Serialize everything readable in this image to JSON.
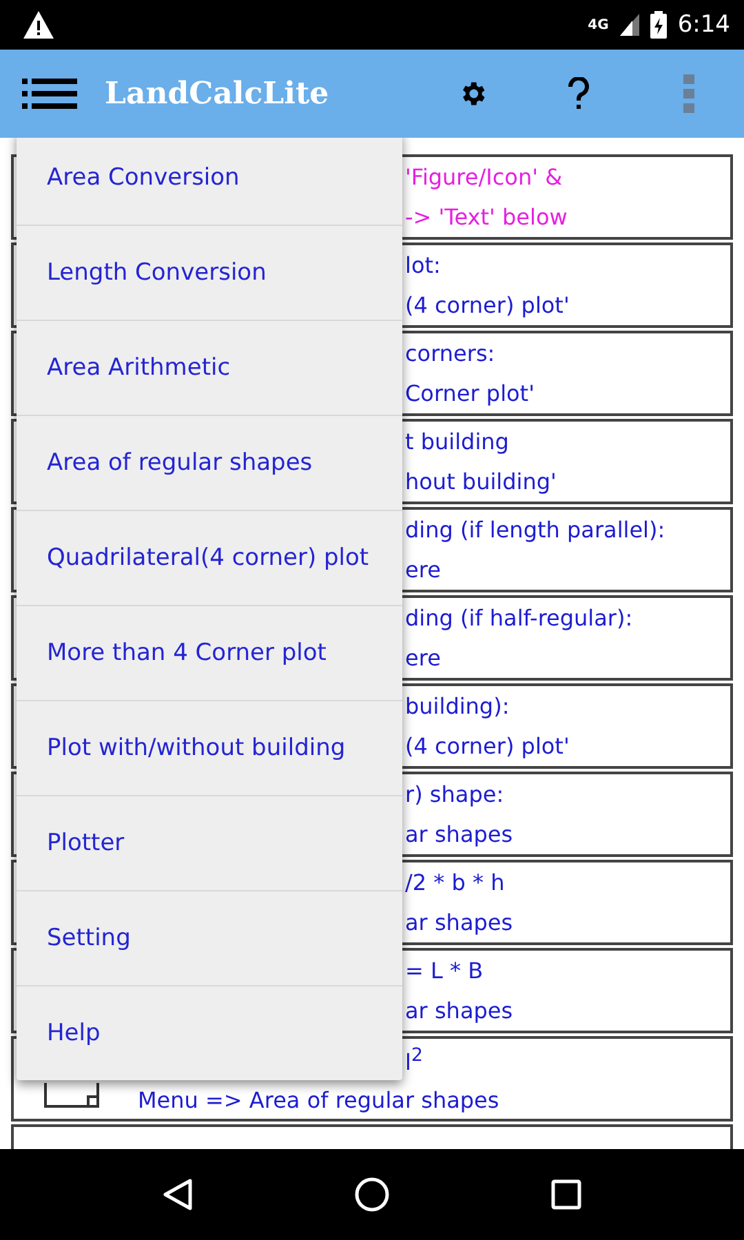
{
  "status_bar": {
    "time": "6:14",
    "network": "4G"
  },
  "app_bar": {
    "title": "LandCalcLite"
  },
  "rows": [
    {
      "lines": [
        "'Figure/Icon'  &",
        "-> 'Text' below"
      ],
      "kind": "hint"
    },
    {
      "lines": [
        "lot:",
        "(4 corner) plot'"
      ],
      "kind": "info"
    },
    {
      "lines": [
        "corners:",
        "Corner plot'"
      ],
      "kind": "info"
    },
    {
      "lines": [
        "t building",
        "hout building'"
      ],
      "kind": "info"
    },
    {
      "lines": [
        "ding (if length parallel):",
        "ere"
      ],
      "kind": "info"
    },
    {
      "lines": [
        "ding (if half-regular):",
        "ere"
      ],
      "kind": "info"
    },
    {
      "lines": [
        "building):",
        "(4 corner) plot'"
      ],
      "kind": "info"
    },
    {
      "lines": [
        "r) shape:",
        "ar shapes"
      ],
      "kind": "info"
    },
    {
      "lines": [
        "/2 * b * h",
        "ar shapes"
      ],
      "kind": "info"
    },
    {
      "lines": [
        "= L * B",
        "ar shapes"
      ],
      "kind": "info"
    },
    {
      "lines": [
        "l$^{2}$",
        "Menu => Area of regular shapes"
      ],
      "kind": "square"
    }
  ],
  "menu": {
    "items": [
      "Area Conversion",
      "Length Conversion",
      "Area Arithmetic",
      "Area of regular shapes",
      "Quadrilateral(4 corner) plot",
      "More than 4 Corner plot",
      "Plot with/without building",
      "Plotter",
      "Setting",
      "Help"
    ]
  }
}
